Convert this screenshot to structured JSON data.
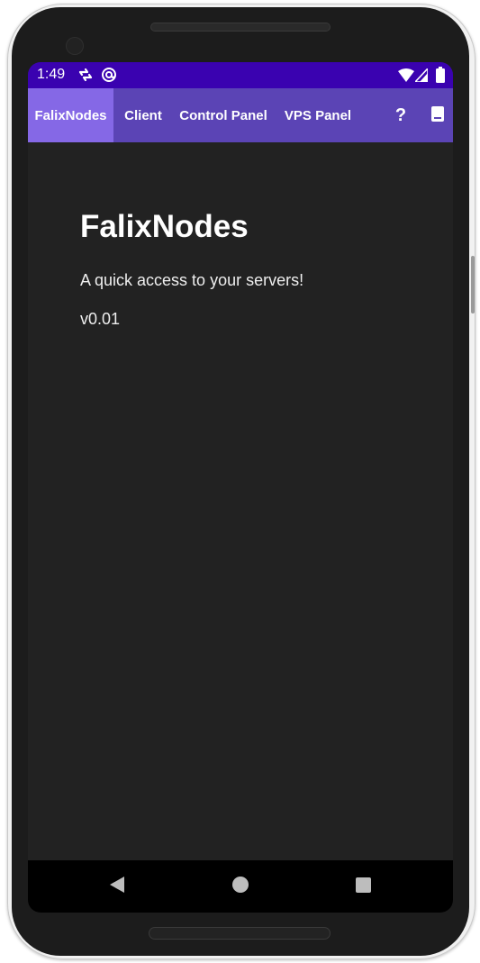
{
  "status_bar": {
    "time": "1:49",
    "left_icons": [
      "sync-arrows-icon",
      "at-sign-icon"
    ],
    "right_icons": [
      "wifi-icon",
      "cell-signal-icon",
      "battery-icon"
    ]
  },
  "top_bar": {
    "tabs": [
      {
        "label": "FalixNodes",
        "active": true
      },
      {
        "label": "Client",
        "active": false
      },
      {
        "label": "Control Panel",
        "active": false
      },
      {
        "label": "VPS Panel",
        "active": false
      }
    ],
    "actions": [
      {
        "label": "?",
        "icon": "help-icon"
      },
      {
        "icon": "book-icon"
      }
    ]
  },
  "main": {
    "title": "FalixNodes",
    "subtitle": "A quick access to your servers!",
    "version": "v0.01"
  },
  "nav_bar": {
    "buttons": [
      "back-icon",
      "home-icon",
      "recents-icon"
    ]
  },
  "colors": {
    "status_bar": "#3a02b0",
    "top_bar": "#5b44b5",
    "active_tab": "#8568e6",
    "screen_bg": "#222222",
    "nav_bar": "#000000"
  }
}
